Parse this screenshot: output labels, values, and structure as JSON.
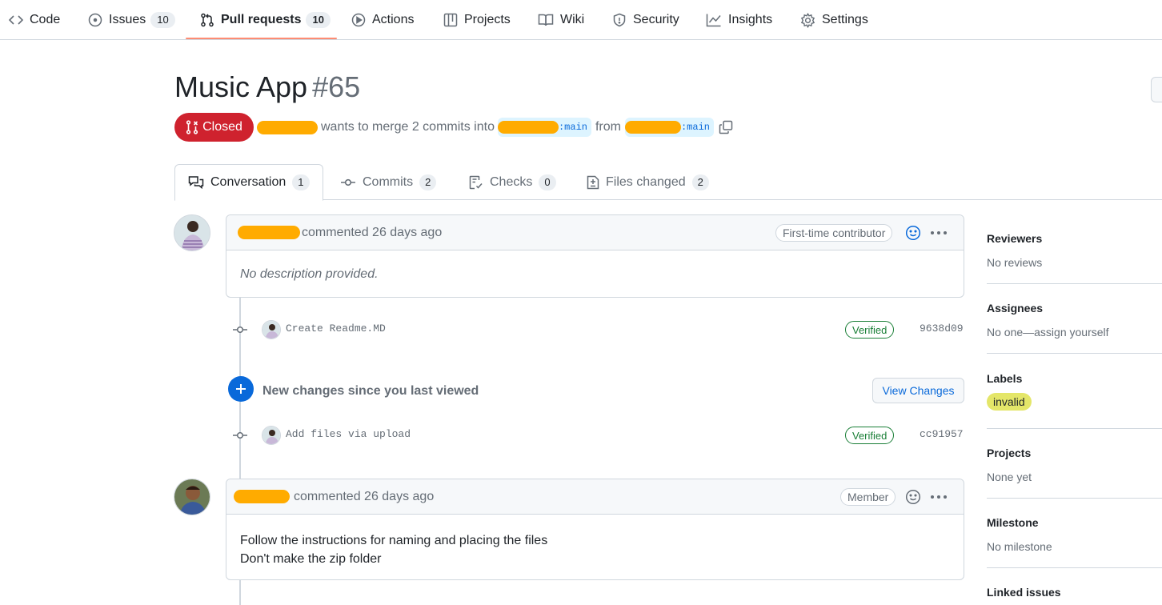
{
  "nav": {
    "items": [
      {
        "label": "Code",
        "icon": "code-icon"
      },
      {
        "label": "Issues",
        "icon": "issue-opened-icon",
        "count": "10"
      },
      {
        "label": "Pull requests",
        "icon": "git-pull-request-icon",
        "count": "10",
        "selected": true
      },
      {
        "label": "Actions",
        "icon": "play-icon"
      },
      {
        "label": "Projects",
        "icon": "table-icon"
      },
      {
        "label": "Wiki",
        "icon": "book-icon"
      },
      {
        "label": "Security",
        "icon": "shield-icon"
      },
      {
        "label": "Insights",
        "icon": "graph-icon"
      },
      {
        "label": "Settings",
        "icon": "gear-icon"
      }
    ]
  },
  "pr": {
    "title": "Music App",
    "number": "#65",
    "state": "Closed",
    "merge_text": "wants to merge 2 commits into",
    "base_branch": ":main",
    "from_text": "from",
    "head_branch": ":main"
  },
  "tabs": [
    {
      "label": "Conversation",
      "count": "1",
      "icon": "comment-discussion-icon"
    },
    {
      "label": "Commits",
      "count": "2",
      "icon": "git-commit-icon"
    },
    {
      "label": "Checks",
      "count": "0",
      "icon": "checklist-icon"
    },
    {
      "label": "Files changed",
      "count": "2",
      "icon": "file-diff-icon"
    }
  ],
  "comments": [
    {
      "meta": "commented 26 days ago",
      "role": "First-time contributor",
      "body": [
        "No description provided."
      ]
    },
    {
      "meta": "commented 26 days ago",
      "role": "Member",
      "body": [
        "Follow the instructions for naming and placing the files",
        "Don't make the zip folder"
      ]
    }
  ],
  "commits": [
    {
      "message": "Create Readme.MD",
      "status": "Verified",
      "sha": "9638d09"
    },
    {
      "message": "Add files via upload",
      "status": "Verified",
      "sha": "cc91957"
    }
  ],
  "new_changes": {
    "text": "New changes since you last viewed",
    "button": "View Changes"
  },
  "sidebar": {
    "reviewers": {
      "title": "Reviewers",
      "value": "No reviews"
    },
    "assignees": {
      "title": "Assignees",
      "value": "No one—assign yourself"
    },
    "labels": {
      "title": "Labels",
      "value": "invalid"
    },
    "projects": {
      "title": "Projects",
      "value": "None yet"
    },
    "milestone": {
      "title": "Milestone",
      "value": "No milestone"
    },
    "linked_issues": {
      "title": "Linked issues"
    }
  },
  "colors": {
    "closed": "#cf222e",
    "accent": "#0969da",
    "verified": "#1a7f37",
    "label_invalid": "#e4e669",
    "nav_underline": "#fd8c73"
  }
}
